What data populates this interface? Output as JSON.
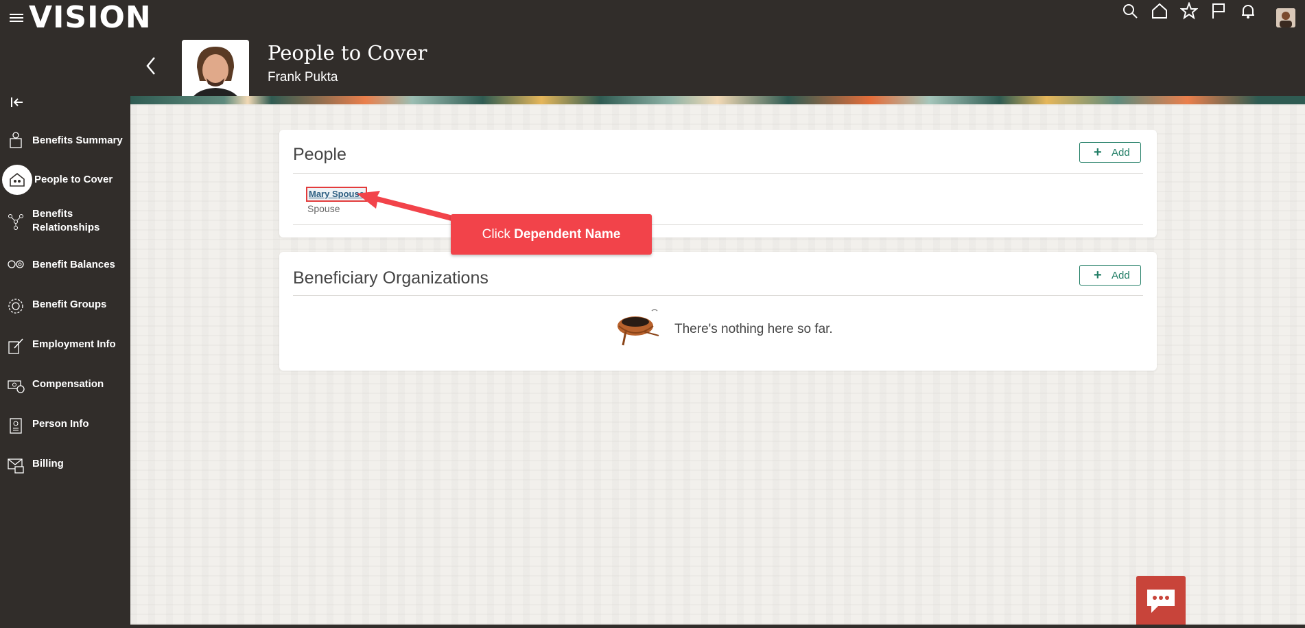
{
  "app": {
    "logo_text": "vision"
  },
  "topbar": {
    "icons": [
      "search-icon",
      "home-icon",
      "favorites-star-icon",
      "flag-icon",
      "notifications-bell-icon"
    ],
    "user_avatar": "user-avatar"
  },
  "header": {
    "title": "People to Cover",
    "subtitle": "Frank Pukta",
    "photo_more_label": "•••"
  },
  "sidebar": {
    "items": [
      {
        "label": "Benefits Summary",
        "icon": "benefits-summary-icon",
        "active": false
      },
      {
        "label": "People to Cover",
        "icon": "people-to-cover-icon",
        "active": true
      },
      {
        "label": "Benefits Relationships",
        "icon": "relationships-icon",
        "active": false
      },
      {
        "label": "Benefit Balances",
        "icon": "balances-icon",
        "active": false
      },
      {
        "label": "Benefit Groups",
        "icon": "groups-icon",
        "active": false
      },
      {
        "label": "Employment Info",
        "icon": "employment-icon",
        "active": false
      },
      {
        "label": "Compensation",
        "icon": "compensation-icon",
        "active": false
      },
      {
        "label": "Person Info",
        "icon": "person-info-icon",
        "active": false
      },
      {
        "label": "Billing",
        "icon": "billing-icon",
        "active": false
      }
    ]
  },
  "people_card": {
    "title": "People",
    "add_label": "Add",
    "dependents": [
      {
        "name": "Mary Spouse",
        "relationship": "Spouse"
      }
    ]
  },
  "orgs_card": {
    "title": "Beneficiary Organizations",
    "add_label": "Add",
    "empty_message": "There's nothing here so far."
  },
  "callout": {
    "prefix": "Click ",
    "emphasis": "Dependent Name"
  },
  "colors": {
    "accent_green": "#227e66",
    "callout_red": "#f2434a",
    "chrome_dark": "#312d2a"
  }
}
